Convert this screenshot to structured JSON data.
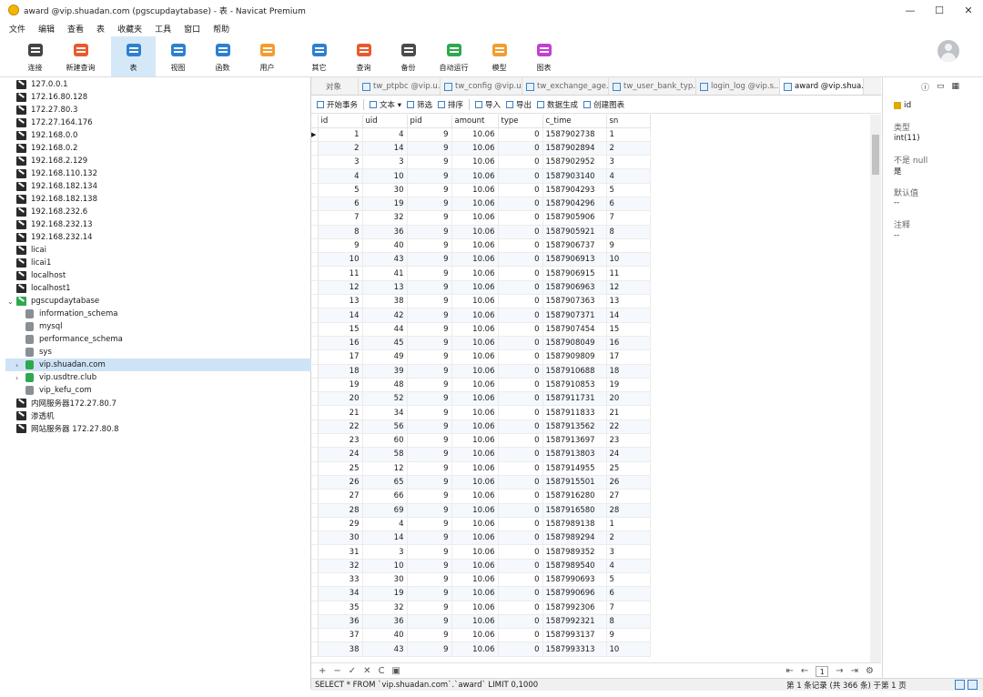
{
  "window": {
    "title": "award @vip.shuadan.com (pgscupdaytabase) - 表 - Navicat Premium",
    "min": "—",
    "max": "☐",
    "close": "✕"
  },
  "menu": [
    "文件",
    "编辑",
    "查看",
    "表",
    "收藏夹",
    "工具",
    "窗口",
    "帮助"
  ],
  "toolbar": [
    {
      "label": "连接",
      "icon": "plug-icon"
    },
    {
      "label": "新建查询",
      "icon": "new-query-icon"
    },
    {
      "label": "表",
      "icon": "table-icon",
      "active": true
    },
    {
      "label": "视图",
      "icon": "view-icon"
    },
    {
      "label": "函数",
      "icon": "function-icon"
    },
    {
      "label": "用户",
      "icon": "user-icon"
    },
    {
      "label": "其它",
      "icon": "tools-icon"
    },
    {
      "label": "查询",
      "icon": "query-icon"
    },
    {
      "label": "备份",
      "icon": "backup-icon"
    },
    {
      "label": "自动运行",
      "icon": "robot-icon"
    },
    {
      "label": "模型",
      "icon": "model-icon"
    },
    {
      "label": "图表",
      "icon": "chart-icon"
    }
  ],
  "sidebar": {
    "items": [
      {
        "label": "127.0.0.1",
        "kind": "conn"
      },
      {
        "label": "172.16.80.128",
        "kind": "conn"
      },
      {
        "label": "172.27.80.3",
        "kind": "conn"
      },
      {
        "label": "172.27.164.176",
        "kind": "conn"
      },
      {
        "label": "192.168.0.0",
        "kind": "conn"
      },
      {
        "label": "192.168.0.2",
        "kind": "conn"
      },
      {
        "label": "192.168.2.129",
        "kind": "conn"
      },
      {
        "label": "192.168.110.132",
        "kind": "conn"
      },
      {
        "label": "192.168.182.134",
        "kind": "conn"
      },
      {
        "label": "192.168.182.138",
        "kind": "conn"
      },
      {
        "label": "192.168.232.6",
        "kind": "conn"
      },
      {
        "label": "192.168.232.13",
        "kind": "conn"
      },
      {
        "label": "192.168.232.14",
        "kind": "conn"
      },
      {
        "label": "licai",
        "kind": "conn"
      },
      {
        "label": "licai1",
        "kind": "conn"
      },
      {
        "label": "localhost",
        "kind": "conn"
      },
      {
        "label": "localhost1",
        "kind": "conn"
      },
      {
        "label": "pgscupdaytabase",
        "kind": "conn-open",
        "arrow": "⌄"
      },
      {
        "label": "information_schema",
        "kind": "db"
      },
      {
        "label": "mysql",
        "kind": "db"
      },
      {
        "label": "performance_schema",
        "kind": "db"
      },
      {
        "label": "sys",
        "kind": "db"
      },
      {
        "label": "vip.shuadan.com",
        "kind": "db-open",
        "arrow": "›",
        "selected": true
      },
      {
        "label": "vip.usdtre.club",
        "kind": "db-open",
        "arrow": "›"
      },
      {
        "label": "vip_kefu_com",
        "kind": "db"
      },
      {
        "label": "内网服务器172.27.80.7",
        "kind": "conn"
      },
      {
        "label": "渗透机",
        "kind": "conn"
      },
      {
        "label": "网站服务器 172.27.80.8",
        "kind": "conn"
      }
    ]
  },
  "tabs": [
    {
      "label": "对象",
      "first": true
    },
    {
      "label": "tw_ptpbc @vip.u..."
    },
    {
      "label": "tw_config @vip.u..."
    },
    {
      "label": "tw_exchange_age..."
    },
    {
      "label": "tw_user_bank_typ..."
    },
    {
      "label": "login_log @vip.s..."
    },
    {
      "label": "award @vip.shua...",
      "active": true
    }
  ],
  "subtoolbar": [
    "开始事务",
    "文本 ▾",
    "筛选",
    "排序",
    "导入",
    "导出",
    "数据生成",
    "创建图表"
  ],
  "grid": {
    "columns": [
      "id",
      "uid",
      "pid",
      "amount",
      "type",
      "c_time",
      "sn"
    ],
    "rows": [
      [
        "1",
        "4",
        "9",
        "10.06",
        "0",
        "1587902738",
        "1"
      ],
      [
        "2",
        "14",
        "9",
        "10.06",
        "0",
        "1587902894",
        "2"
      ],
      [
        "3",
        "3",
        "9",
        "10.06",
        "0",
        "1587902952",
        "3"
      ],
      [
        "4",
        "10",
        "9",
        "10.06",
        "0",
        "1587903140",
        "4"
      ],
      [
        "5",
        "30",
        "9",
        "10.06",
        "0",
        "1587904293",
        "5"
      ],
      [
        "6",
        "19",
        "9",
        "10.06",
        "0",
        "1587904296",
        "6"
      ],
      [
        "7",
        "32",
        "9",
        "10.06",
        "0",
        "1587905906",
        "7"
      ],
      [
        "8",
        "36",
        "9",
        "10.06",
        "0",
        "1587905921",
        "8"
      ],
      [
        "9",
        "40",
        "9",
        "10.06",
        "0",
        "1587906737",
        "9"
      ],
      [
        "10",
        "43",
        "9",
        "10.06",
        "0",
        "1587906913",
        "10"
      ],
      [
        "11",
        "41",
        "9",
        "10.06",
        "0",
        "1587906915",
        "11"
      ],
      [
        "12",
        "13",
        "9",
        "10.06",
        "0",
        "1587906963",
        "12"
      ],
      [
        "13",
        "38",
        "9",
        "10.06",
        "0",
        "1587907363",
        "13"
      ],
      [
        "14",
        "42",
        "9",
        "10.06",
        "0",
        "1587907371",
        "14"
      ],
      [
        "15",
        "44",
        "9",
        "10.06",
        "0",
        "1587907454",
        "15"
      ],
      [
        "16",
        "45",
        "9",
        "10.06",
        "0",
        "1587908049",
        "16"
      ],
      [
        "17",
        "49",
        "9",
        "10.06",
        "0",
        "1587909809",
        "17"
      ],
      [
        "18",
        "39",
        "9",
        "10.06",
        "0",
        "1587910688",
        "18"
      ],
      [
        "19",
        "48",
        "9",
        "10.06",
        "0",
        "1587910853",
        "19"
      ],
      [
        "20",
        "52",
        "9",
        "10.06",
        "0",
        "1587911731",
        "20"
      ],
      [
        "21",
        "34",
        "9",
        "10.06",
        "0",
        "1587911833",
        "21"
      ],
      [
        "22",
        "56",
        "9",
        "10.06",
        "0",
        "1587913562",
        "22"
      ],
      [
        "23",
        "60",
        "9",
        "10.06",
        "0",
        "1587913697",
        "23"
      ],
      [
        "24",
        "58",
        "9",
        "10.06",
        "0",
        "1587913803",
        "24"
      ],
      [
        "25",
        "12",
        "9",
        "10.06",
        "0",
        "1587914955",
        "25"
      ],
      [
        "26",
        "65",
        "9",
        "10.06",
        "0",
        "1587915501",
        "26"
      ],
      [
        "27",
        "66",
        "9",
        "10.06",
        "0",
        "1587916280",
        "27"
      ],
      [
        "28",
        "69",
        "9",
        "10.06",
        "0",
        "1587916580",
        "28"
      ],
      [
        "29",
        "4",
        "9",
        "10.06",
        "0",
        "1587989138",
        "1"
      ],
      [
        "30",
        "14",
        "9",
        "10.06",
        "0",
        "1587989294",
        "2"
      ],
      [
        "31",
        "3",
        "9",
        "10.06",
        "0",
        "1587989352",
        "3"
      ],
      [
        "32",
        "10",
        "9",
        "10.06",
        "0",
        "1587989540",
        "4"
      ],
      [
        "33",
        "30",
        "9",
        "10.06",
        "0",
        "1587990693",
        "5"
      ],
      [
        "34",
        "19",
        "9",
        "10.06",
        "0",
        "1587990696",
        "6"
      ],
      [
        "35",
        "32",
        "9",
        "10.06",
        "0",
        "1587992306",
        "7"
      ],
      [
        "36",
        "36",
        "9",
        "10.06",
        "0",
        "1587992321",
        "8"
      ],
      [
        "37",
        "40",
        "9",
        "10.06",
        "0",
        "1587993137",
        "9"
      ],
      [
        "38",
        "43",
        "9",
        "10.06",
        "0",
        "1587993313",
        "10"
      ]
    ]
  },
  "bottomnav": {
    "left": [
      "+",
      "−",
      "✓",
      "✕",
      "C",
      "▣"
    ],
    "right": [
      "⇤",
      "←",
      "1",
      "→",
      "⇥",
      "⚙"
    ]
  },
  "status": {
    "sql": "SELECT * FROM `vip.shuadan.com`.`award` LIMIT 0,1000",
    "records": "第 1 条记录 (共 366 条) 于第 1 页"
  },
  "info": {
    "field": "id",
    "labels": [
      "类型",
      "不是 null",
      "默认值",
      "注释"
    ],
    "values": [
      "int(11)",
      "是",
      "--",
      "--"
    ]
  }
}
